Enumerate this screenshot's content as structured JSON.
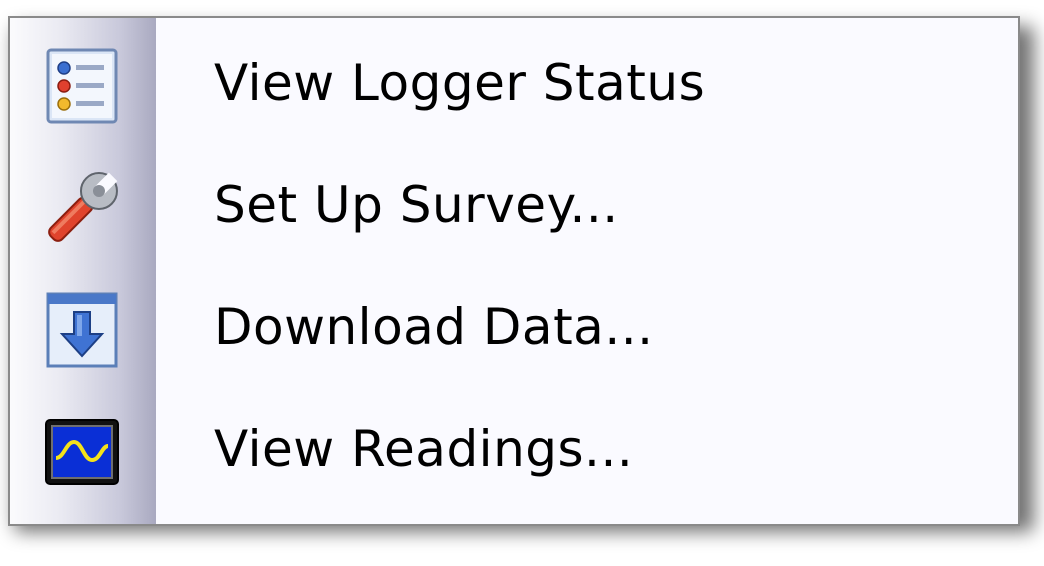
{
  "menu": {
    "items": [
      {
        "label": "View Logger Status",
        "icon": "status-list-icon"
      },
      {
        "label": "Set Up Survey...",
        "icon": "wrench-icon"
      },
      {
        "label": "Download Data...",
        "icon": "download-arrow-icon"
      },
      {
        "label": "View Readings...",
        "icon": "waveform-monitor-icon"
      }
    ]
  },
  "colors": {
    "menu_background": "#fafaff",
    "gutter_dark": "#a9a9c0",
    "text": "#000000"
  }
}
